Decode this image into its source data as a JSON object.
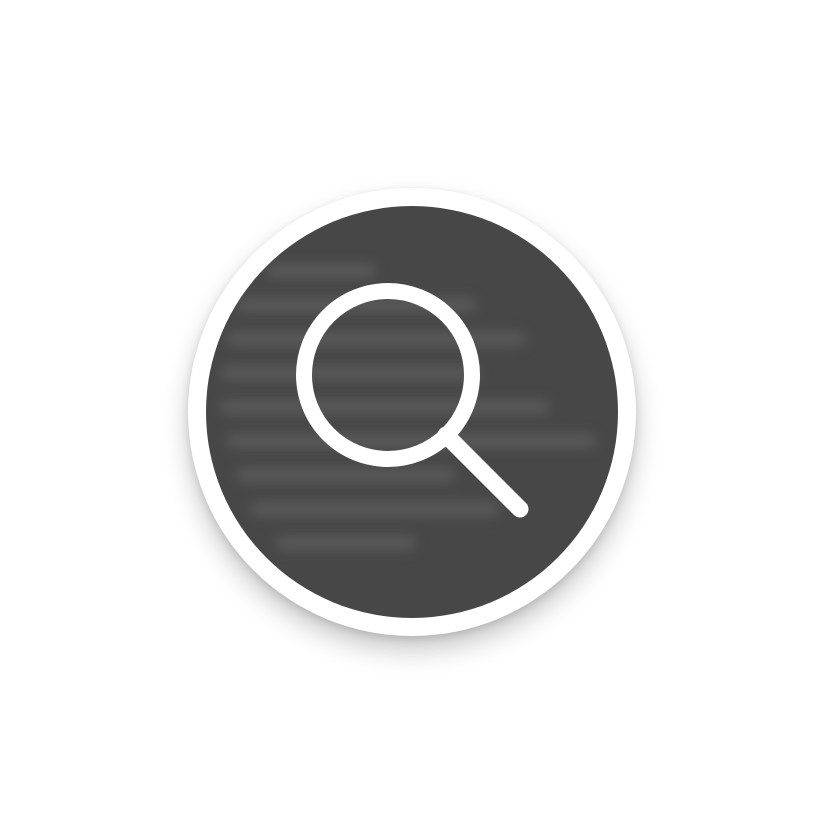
{
  "app_icon": {
    "icon": "magnifying-glass-icon",
    "disc_color": "#474747",
    "ring_color": "#ffffff",
    "glyph_color": "#ffffff",
    "background_color": "#ffffff"
  }
}
